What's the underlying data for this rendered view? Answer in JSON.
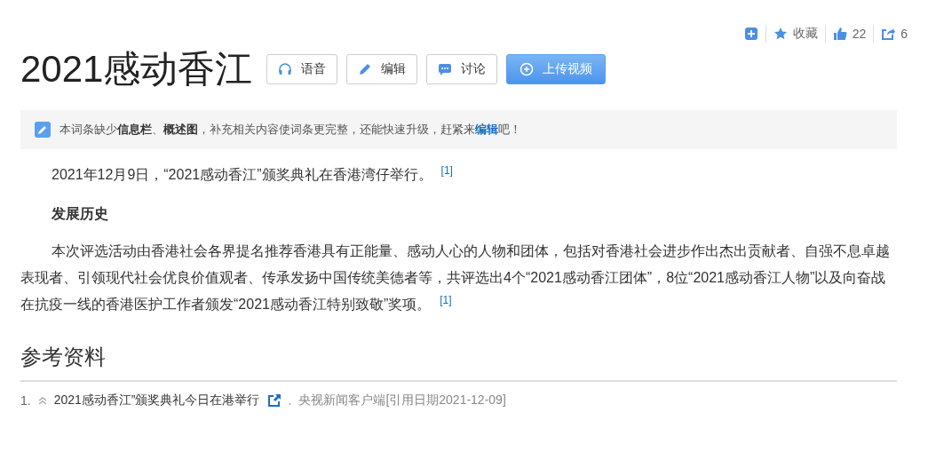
{
  "actions": [
    {
      "kind": "add"
    },
    {
      "kind": "star",
      "label": "收藏"
    },
    {
      "kind": "like",
      "label": "22"
    },
    {
      "kind": "share",
      "label": "6"
    }
  ],
  "title": "2021感动香江",
  "buttons": [
    {
      "kind": "audio",
      "label": "语音",
      "primary": false
    },
    {
      "kind": "edit",
      "label": "编辑",
      "primary": false
    },
    {
      "kind": "discuss",
      "label": "讨论",
      "primary": false
    },
    {
      "kind": "upload",
      "label": "上传视频",
      "primary": true
    }
  ],
  "notice": {
    "text": "本词条缺少**信息栏**、**概述图**，补充相关内容使词条更完整，还能快速升级，赶紧来",
    "link": "编辑",
    "after": "吧！"
  },
  "content": [
    {
      "kind": "para",
      "text": "2021年12月9日，“2021感动香江”颁奖典礼在香港湾仔举行。",
      "cite": "[1]"
    },
    {
      "kind": "heading",
      "text": "发展历史"
    },
    {
      "kind": "para",
      "text": "本次评选活动由香港社会各界提名推荐香港具有正能量、感动人心的人物和团体，包括对香港社会进步作出杰出贡献者、自强不息卓越表现者、引领现代社会优良价值观者、传承发扬中国传统美德者等，共评选出4个“2021感动香江团体”，8位“2021感动香江人物”以及向奋战在抗疫一线的香港医护工作者颁发“2021感动香江特别致敬”奖项。",
      "cite": "[1]"
    }
  ],
  "references": {
    "title": "参考资料",
    "items": [
      {
        "number": "1.",
        "title": "2021感动香江”颁奖典礼今日在港举行",
        "dot": ".",
        "source": "央视新闻客户端[引用日期2021-12-09]"
      }
    ]
  }
}
